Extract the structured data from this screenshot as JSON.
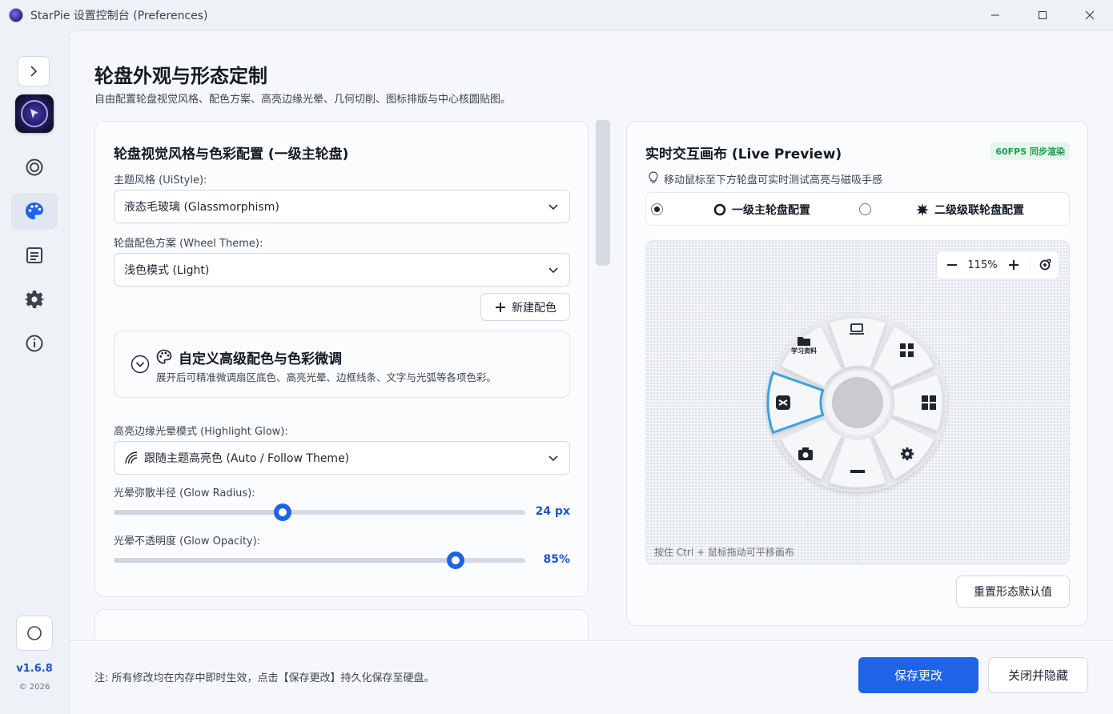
{
  "window": {
    "title": "StarPie 设置控制台 (Preferences)"
  },
  "sidebar": {
    "version": "v1.6.8",
    "copyright": "© 2026",
    "nav": [
      {
        "icon": "target-icon"
      },
      {
        "icon": "palette-icon",
        "active": true
      },
      {
        "icon": "document-icon"
      },
      {
        "icon": "gear-icon"
      },
      {
        "icon": "info-icon"
      }
    ]
  },
  "page": {
    "title": "轮盘外观与形态定制",
    "subtitle": "自由配置轮盘视觉风格、配色方案、高亮边缘光晕、几何切削、图标排版与中心核圆贴图。"
  },
  "style_card": {
    "title": "轮盘视觉风格与色彩配置 (一级主轮盘)",
    "ui_style_label": "主题风格 (UiStyle):",
    "ui_style_value": "液态毛玻璃 (Glassmorphism)",
    "theme_label": "轮盘配色方案 (Wheel Theme):",
    "theme_value": "浅色模式 (Light)",
    "new_color_button": "新建配色",
    "advanced_title": "自定义高级配色与色彩微调",
    "advanced_desc": "展开后可精准微调扇区底色、高亮光晕、边框线条、文字与光弧等各项色彩。",
    "glow_mode_label": "高亮边缘光晕模式 (Highlight Glow):",
    "glow_mode_value": "跟随主题高亮色 (Auto / Follow Theme)",
    "glow_radius_label": "光晕弥散半径 (Glow Radius):",
    "glow_radius_value": "24 px",
    "glow_radius_fraction": 0.41,
    "glow_opacity_label": "光晕不透明度 (Glow Opacity):",
    "glow_opacity_value": "85%",
    "glow_opacity_fraction": 0.83
  },
  "preview": {
    "title": "实时交互画布 (Live Preview)",
    "badge": "60FPS 同步渲染",
    "hint": "移动鼠标至下方轮盘可实时测试高亮与磁吸手感",
    "option_primary": "一级主轮盘配置",
    "option_secondary": "二级级联轮盘配置",
    "selected_option": "primary",
    "zoom": "115%",
    "canvas_hint": "按住 Ctrl + 鼠标拖动可平移画布",
    "sector_label": "学习资料",
    "reset_button": "重置形态默认值"
  },
  "footer": {
    "note": "注: 所有修改均在内存中即时生效，点击【保存更改】持久化保存至硬盘。",
    "save_button": "保存更改",
    "close_button": "关闭并隐藏"
  },
  "colors": {
    "accent": "#1f63e6",
    "highlight": "#3aa3e0",
    "badge_green": "#1e9a52"
  }
}
